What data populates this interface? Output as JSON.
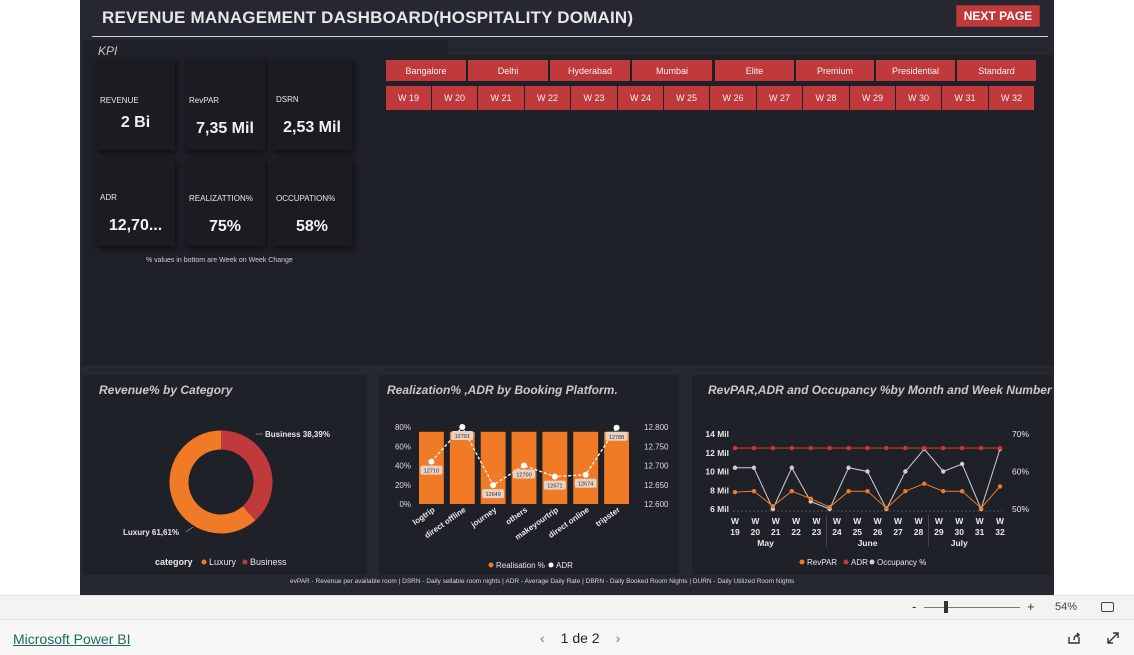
{
  "header": {
    "title": "REVENUE MANAGEMENT DASHBOARD(HOSPITALITY DOMAIN)",
    "next_page_label": "NEXT PAGE"
  },
  "kpi": {
    "section_label": "KPI",
    "cards": [
      {
        "label": "REVENUE",
        "value": "2 Bi"
      },
      {
        "label": "RevPAR",
        "value": "7,35 Mil"
      },
      {
        "label": "DSRN",
        "value": "2,53 Mil"
      },
      {
        "label": "ADR",
        "value": "12,70..."
      },
      {
        "label": "REALIZATTION%",
        "value": "75%"
      },
      {
        "label": "OCCUPATION%",
        "value": "58%"
      }
    ],
    "note": "% values in bottom are Week on Week Change"
  },
  "slicers": {
    "cities": [
      "Bangalore",
      "Delhi",
      "Hyderabad",
      "Mumbai"
    ],
    "room_classes": [
      "Elite",
      "Premium",
      "Presidential",
      "Standard"
    ],
    "weeks": [
      "W 19",
      "W 20",
      "W 21",
      "W 22",
      "W 23",
      "W 24",
      "W 25",
      "W 26",
      "W 27",
      "W 28",
      "W 29",
      "W 30",
      "W 31",
      "W 32"
    ]
  },
  "colors": {
    "accent_red": "#c0393b",
    "orange": "#f07a26",
    "white": "#ffffff",
    "background": "#252830"
  },
  "chart_data": [
    {
      "type": "pie",
      "title": "Revenue% by Category",
      "legend_title": "category",
      "categories": [
        "Luxury",
        "Business"
      ],
      "values": [
        61.61,
        38.39
      ],
      "data_labels": [
        "Luxury 61,61%",
        "Business 38,39%"
      ],
      "colors": [
        "#f07a26",
        "#c0393b"
      ]
    },
    {
      "type": "bar",
      "title": "Realization% ,ADR by Booking Platform.",
      "categories": [
        "logtrip",
        "direct offline",
        "journey",
        "others",
        "makeyourtrip",
        "direct online",
        "tripster"
      ],
      "y_left_ticks": [
        "0%",
        "20%",
        "40%",
        "60%",
        "80%"
      ],
      "y_right_ticks": [
        "12.600",
        "12.650",
        "12.700",
        "12.750",
        "12.800"
      ],
      "ylim_right": [
        12600,
        12800
      ],
      "series": [
        {
          "name": "Realisation %",
          "values": [
            75,
            75,
            75,
            75,
            75,
            75,
            75
          ]
        },
        {
          "name": "ADR",
          "values": [
            12710,
            12800,
            12649,
            12700,
            12671,
            12676,
            12798
          ]
        }
      ],
      "data_labels": [
        "12710",
        "12791",
        "12649",
        "12700",
        "12671",
        "12674",
        "12788"
      ]
    },
    {
      "type": "line",
      "title": "RevPAR,ADR and Occupancy %by Month and Week Number",
      "x_weeks": [
        "19",
        "20",
        "21",
        "22",
        "23",
        "24",
        "25",
        "26",
        "27",
        "28",
        "29",
        "30",
        "31",
        "32"
      ],
      "x_prefix": "W",
      "months": [
        "May",
        "June",
        "July"
      ],
      "y_left_ticks": [
        "6 Mil",
        "8 Mil",
        "10 Mil",
        "12 Mil",
        "14 Mil"
      ],
      "ylim_left": [
        6,
        14
      ],
      "y_right_ticks": [
        "50%",
        "60%",
        "70%"
      ],
      "ylim_right": [
        50,
        70
      ],
      "series": [
        {
          "name": "RevPAR",
          "values": [
            7.8,
            7.9,
            6.3,
            7.9,
            7.1,
            6.2,
            7.9,
            7.9,
            6.1,
            7.9,
            8.7,
            7.9,
            7.9,
            6.1,
            8.4
          ]
        },
        {
          "name": "ADR",
          "values": [
            12.5,
            12.5,
            12.5,
            12.5,
            12.5,
            12.5,
            12.5,
            12.5,
            12.5,
            12.5,
            12.5,
            12.5,
            12.5,
            12.5,
            12.5
          ]
        },
        {
          "name": "Occupancy %",
          "values": [
            61,
            61,
            50,
            61,
            52,
            50,
            61,
            60,
            50,
            60,
            66,
            60,
            62,
            50,
            66
          ]
        }
      ]
    }
  ],
  "footnote": "evPAR - Revenue per available room | DSRN - Daily sellable room nights | ADR - Average Daily Rate | DBRN - Daily Booked Room Nights | DURN - Daily Utilized Room Nights",
  "statusbar": {
    "zoom_percent": "54%",
    "zoom_minus": "-",
    "zoom_plus": "+"
  },
  "bottombar": {
    "brand_link": "Microsoft Power BI",
    "page_indicator": "1 de 2",
    "prev": "‹",
    "next": "›"
  }
}
